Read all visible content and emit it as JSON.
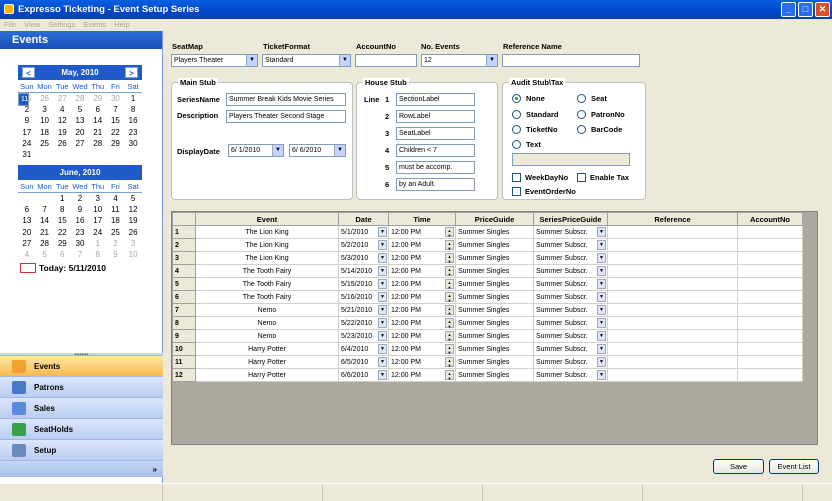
{
  "window": {
    "title": "Expresso Ticketing - Event Setup Series",
    "buttons": {
      "minimize": "_",
      "maximize": "□",
      "close": "✕"
    }
  },
  "menu": [
    "File",
    "View",
    "Settings",
    "Events",
    "Help"
  ],
  "sidebar": {
    "title": "Events",
    "today_label": "Today: 5/11/2010",
    "expand": "»",
    "nav": [
      {
        "label": "Events",
        "color": "#f2a02e"
      },
      {
        "label": "Patrons",
        "color": "#4a78c8"
      },
      {
        "label": "Sales",
        "color": "#5a8ae0"
      },
      {
        "label": "SeatHolds",
        "color": "#3aa04a"
      },
      {
        "label": "Setup",
        "color": "#6a8ac0"
      }
    ]
  },
  "calendar": {
    "may": {
      "title": "May, 2010",
      "prev": "<",
      "next": ">"
    },
    "june": {
      "title": "June, 2010"
    },
    "dow": [
      "Sun",
      "Mon",
      "Tue",
      "Wed",
      "Thu",
      "Fri",
      "Sat"
    ]
  },
  "header": {
    "seatmap_label": "SeatMap",
    "seatmap": "Players Theater",
    "ticketformat_label": "TicketFormat",
    "ticketformat": "Standard",
    "accountno_label": "AccountNo",
    "accountno": "",
    "events_label": "No. Events",
    "events": "12",
    "reference_label": "Reference Name",
    "reference": ""
  },
  "mainstub": {
    "title": "Main Stub",
    "seriesname_label": "SeriesName",
    "seriesname": "Summer Break Kids Movie Series",
    "description_label": "Description",
    "description": "Players Theater Second Stage",
    "displaydate_label": "DisplayDate",
    "date1": "6/ 1/2010",
    "date2": "6/ 6/2010"
  },
  "housestub": {
    "title": "House Stub",
    "line_label": "Line",
    "lines": [
      {
        "n": "1",
        "v": "SectionLabel"
      },
      {
        "n": "2",
        "v": "RowLabel"
      },
      {
        "n": "3",
        "v": "SeatLabel"
      },
      {
        "n": "4",
        "v": "Children < 7"
      },
      {
        "n": "5",
        "v": "must be accomp."
      },
      {
        "n": "6",
        "v": "by an Adult."
      }
    ]
  },
  "audit": {
    "title": "Audit Stub\\Tax",
    "none": "None",
    "standard": "Standard",
    "ticketno": "TicketNo",
    "text": "Text",
    "seat": "Seat",
    "patronno": "PatronNo",
    "barcode": "BarCode",
    "weekdayno": "WeekDayNo",
    "enabletax": "Enable Tax",
    "eventorderno": "EventOrderNo"
  },
  "table": {
    "headers": [
      "Event",
      "Date",
      "Time",
      "PriceGuide",
      "SeriesPriceGuide",
      "Reference",
      "AccountNo"
    ],
    "rows": [
      {
        "n": "1",
        "event": "The Lion King",
        "date": "5/1/2010",
        "time": "12:00 PM",
        "pg": "Summer Singles",
        "spg": "Summer Subscr."
      },
      {
        "n": "2",
        "event": "The Lion King",
        "date": "5/2/2010",
        "time": "12:00 PM",
        "pg": "Summer Singles",
        "spg": "Summer Subscr."
      },
      {
        "n": "3",
        "event": "The Lion King",
        "date": "5/3/2010",
        "time": "12:00 PM",
        "pg": "Summer Singles",
        "spg": "Summer Subscr."
      },
      {
        "n": "4",
        "event": "The Tooth Fairy",
        "date": "5/14/2010",
        "time": "12:00 PM",
        "pg": "Summer Singles",
        "spg": "Summer Subscr."
      },
      {
        "n": "5",
        "event": "The Tooth Fairy",
        "date": "5/15/2010",
        "time": "12:00 PM",
        "pg": "Summer Singles",
        "spg": "Summer Subscr."
      },
      {
        "n": "6",
        "event": "The Tooth Fairy",
        "date": "5/16/2010",
        "time": "12:00 PM",
        "pg": "Summer Singles",
        "spg": "Summer Subscr."
      },
      {
        "n": "7",
        "event": "Nemo",
        "date": "5/21/2010",
        "time": "12:00 PM",
        "pg": "Summer Singles",
        "spg": "Summer Subscr."
      },
      {
        "n": "8",
        "event": "Nemo",
        "date": "5/22/2010",
        "time": "12:00 PM",
        "pg": "Summer Singles",
        "spg": "Summer Subscr."
      },
      {
        "n": "9",
        "event": "Nemo",
        "date": "5/23/2010",
        "time": "12:00 PM",
        "pg": "Summer Singles",
        "spg": "Summer Subscr."
      },
      {
        "n": "10",
        "event": "Harry Potter",
        "date": "6/4/2010",
        "time": "12:00 PM",
        "pg": "Summer Singles",
        "spg": "Summer Subscr."
      },
      {
        "n": "11",
        "event": "Harry Potter",
        "date": "6/5/2010",
        "time": "12:00 PM",
        "pg": "Summer Singles",
        "spg": "Summer Subscr."
      },
      {
        "n": "12",
        "event": "Harry Potter",
        "date": "6/6/2010",
        "time": "12:00 PM",
        "pg": "Summer Singles",
        "spg": "Summer Subscr."
      }
    ]
  },
  "buttons": {
    "save": "Save",
    "eventlist": "Event List"
  }
}
